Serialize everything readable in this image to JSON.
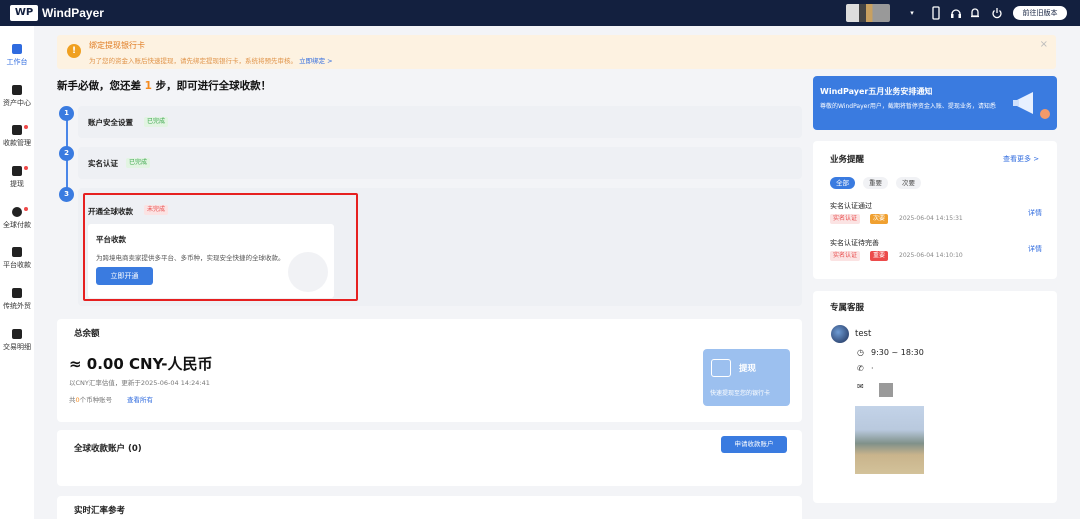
{
  "app": {
    "name": "WindPayer",
    "logo_text": "WP",
    "old_version_label": "前往旧版本"
  },
  "topbar": {
    "icons": [
      "phone-icon",
      "headset-icon",
      "bell-icon",
      "power-icon"
    ]
  },
  "sidebar": {
    "items": [
      {
        "label": "工作台",
        "icon": "home-icon",
        "active": true,
        "badge": false
      },
      {
        "label": "资产中心",
        "icon": "wallet-icon",
        "active": false,
        "badge": false
      },
      {
        "label": "收款管理",
        "icon": "receive-icon",
        "active": false,
        "badge": true
      },
      {
        "label": "提现",
        "icon": "withdraw-icon",
        "active": false,
        "badge": true
      },
      {
        "label": "全球付款",
        "icon": "global-pay-icon",
        "active": false,
        "badge": true
      },
      {
        "label": "平台收款",
        "icon": "platform-icon",
        "active": false,
        "badge": false
      },
      {
        "label": "传统外贸",
        "icon": "trade-icon",
        "active": false,
        "badge": false
      },
      {
        "label": "交易明细",
        "icon": "transactions-icon",
        "active": false,
        "badge": false
      }
    ]
  },
  "notice": {
    "icon": "!",
    "title": "绑定提现银行卡",
    "text": "为了您的资金入账后快速提现，请先绑定提现银行卡，系统将预先审核。",
    "link": "立即绑定 >",
    "close": "×"
  },
  "guide": {
    "prefix": "新手必做，您还差",
    "num": "1",
    "suffix": "步，即可进行全球收款！"
  },
  "steps": [
    {
      "n": "1",
      "label": "账户安全设置",
      "status": "已完成"
    },
    {
      "n": "2",
      "label": "实名认证",
      "status": "已完成"
    },
    {
      "n": "3",
      "label": "开通全球收款",
      "status": "未完成"
    }
  ],
  "platform": {
    "title": "平台收款",
    "desc": "为跨境电商卖家提供多平台、多币种，实现安全快捷的全球收款。",
    "button": "立即开通"
  },
  "balance": {
    "title": "总余额",
    "amount": "≈ 0.00 CNY-人民币",
    "note": "以CNY汇率估值，更新于2025-06-04 14:24:41",
    "accounts_prefix": "共",
    "accounts_count": "0",
    "accounts_suffix": "个币种账号",
    "view_all": "查看所有"
  },
  "withdraw": {
    "label": "提现",
    "sub": "快速提现至您的银行卡"
  },
  "accounts": {
    "title": "全球收款账户 (0)",
    "apply_button": "申请收款账户"
  },
  "rates": {
    "title": "实时汇率参考"
  },
  "banner": {
    "title": "WindPayer五月业务安排通知",
    "text": "尊敬的WindPayer用户，截期将暂停资金入账、提现业务，请知悉"
  },
  "business": {
    "title": "业务提醒",
    "more": "查看更多 >",
    "filters": [
      "全部",
      "重要",
      "次要"
    ],
    "items": [
      {
        "title": "实名认证通过",
        "tag1": "实名认证",
        "tag2": "次要",
        "time": "2025-06-04 14:15:31",
        "detail": "详情"
      },
      {
        "title": "实名认证待完善",
        "tag1": "实名认证",
        "tag2": "重要",
        "time": "2025-06-04 14:10:10",
        "detail": "详情"
      }
    ]
  },
  "service": {
    "title": "专属客服",
    "name": "test",
    "hours": "9:30 ~ 18:30",
    "phone": "·"
  }
}
